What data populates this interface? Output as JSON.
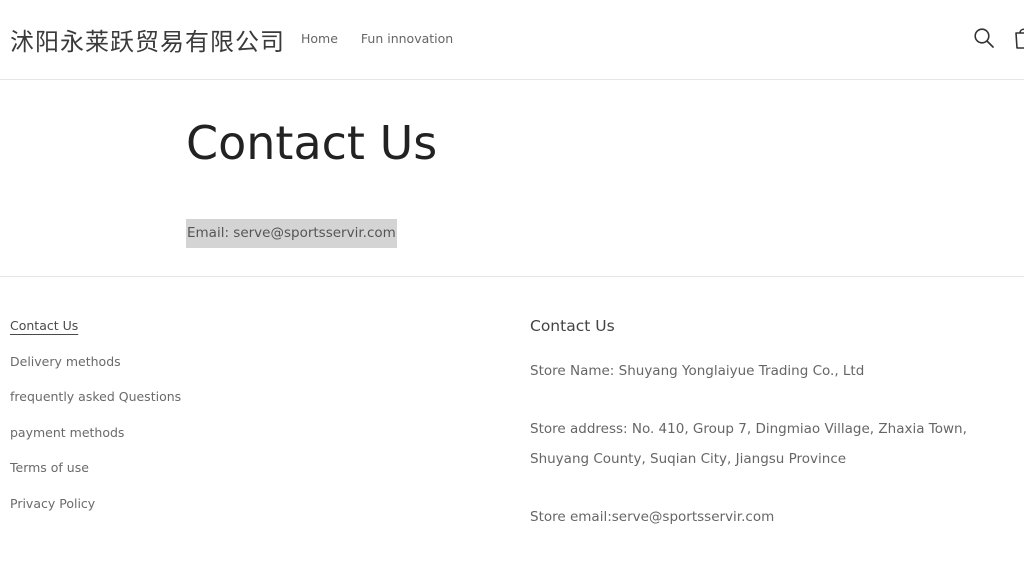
{
  "header": {
    "logo": "沭阳永莱跃贸易有限公司",
    "nav": [
      "Home",
      "Fun innovation"
    ],
    "icons": [
      "search-icon",
      "cart-icon"
    ]
  },
  "main": {
    "title": "Contact Us",
    "email_line": "Email: serve@sportsservir.com"
  },
  "footer": {
    "links": [
      "Contact Us",
      "Delivery methods",
      "frequently asked Questions",
      "payment methods",
      "Terms of use",
      "Privacy Policy"
    ],
    "contact_heading": "Contact Us",
    "store_name": "Store Name: Shuyang Yonglaiyue Trading Co., Ltd",
    "store_address": "Store address: No. 410, Group 7, Dingmiao Village, Zhaxia Town, Shuyang County, Suqian City, Jiangsu Province",
    "store_email": "Store email:serve@sportsservir.com"
  }
}
